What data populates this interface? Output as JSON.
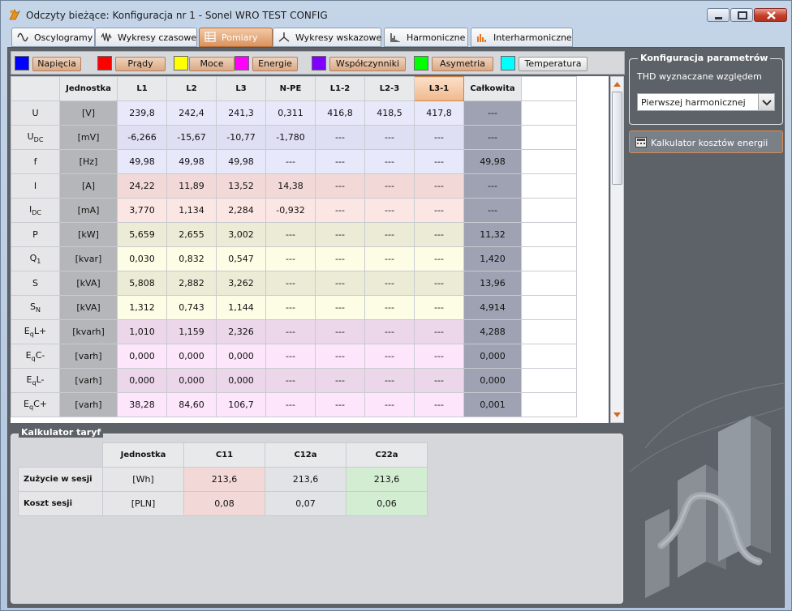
{
  "window": {
    "title": "Odczyty bieżące: Konfiguracja nr 1 - Sonel WRO TEST CONFIG"
  },
  "tabs": [
    {
      "label": "Oscylogramy",
      "icon": "sine-wave-icon",
      "active": false
    },
    {
      "label": "Wykresy czasowe",
      "icon": "waveform-icon",
      "active": false
    },
    {
      "label": "Pomiary",
      "icon": "table-icon",
      "active": true
    },
    {
      "label": "Wykresy wskazowe",
      "icon": "phasor-icon",
      "active": false
    },
    {
      "label": "Harmoniczne",
      "icon": "bar-chart-icon",
      "active": false
    },
    {
      "label": "Interharmoniczne",
      "icon": "bar-chart-color-icon",
      "active": false
    }
  ],
  "filters": [
    {
      "label": "Napięcia",
      "color": "#0000ff",
      "on": true
    },
    {
      "label": "Prądy",
      "color": "#ff0000",
      "on": true
    },
    {
      "label": "Moce",
      "color": "#ffff00",
      "on": true
    },
    {
      "label": "Energie",
      "color": "#ff00ff",
      "on": true
    },
    {
      "label": "Współczynniki",
      "color": "#8000ff",
      "on": true
    },
    {
      "label": "Asymetria",
      "color": "#00ff00",
      "on": true
    },
    {
      "label": "Temperatura",
      "color": "#00ffff",
      "on": false
    }
  ],
  "measurements": {
    "headers": [
      "",
      "Jednostka",
      "L1",
      "L2",
      "L3",
      "N-PE",
      "L1-2",
      "L2-3",
      "L3-1",
      "Całkowita"
    ],
    "selected_column": "L3-1",
    "rows": [
      {
        "param": "U",
        "sub": "",
        "suffix": "",
        "unit": "[V]",
        "values": [
          "239,8",
          "242,4",
          "241,3",
          "0,311",
          "416,8",
          "418,5",
          "417,8",
          "---"
        ],
        "bg": "#e8e8fb"
      },
      {
        "param": "U",
        "sub": "DC",
        "suffix": "",
        "unit": "[mV]",
        "values": [
          "-6,266",
          "-15,67",
          "-10,77",
          "-1,780",
          "---",
          "---",
          "---",
          "---"
        ],
        "bg": "#dfdff4"
      },
      {
        "param": "f",
        "sub": "",
        "suffix": "",
        "unit": "[Hz]",
        "values": [
          "49,98",
          "49,98",
          "49,98",
          "---",
          "---",
          "---",
          "---",
          "49,98"
        ],
        "bg": "#e8e8fb"
      },
      {
        "param": "I",
        "sub": "",
        "suffix": "",
        "unit": "[A]",
        "values": [
          "24,22",
          "11,89",
          "13,52",
          "14,38",
          "---",
          "---",
          "---",
          "---"
        ],
        "bg": "#f2d9d7"
      },
      {
        "param": "I",
        "sub": "DC",
        "suffix": "",
        "unit": "[mA]",
        "values": [
          "3,770",
          "1,134",
          "2,284",
          "-0,932",
          "---",
          "---",
          "---",
          "---"
        ],
        "bg": "#fbe6e4"
      },
      {
        "param": "P",
        "sub": "",
        "suffix": "",
        "unit": "[kW]",
        "values": [
          "5,659",
          "2,655",
          "3,002",
          "---",
          "---",
          "---",
          "---",
          "11,32"
        ],
        "bg": "#ecebd6"
      },
      {
        "param": "Q",
        "sub": "1",
        "suffix": "",
        "unit": "[kvar]",
        "values": [
          "0,030",
          "0,832",
          "0,547",
          "---",
          "---",
          "---",
          "---",
          "1,420"
        ],
        "bg": "#fdfde6"
      },
      {
        "param": "S",
        "sub": "",
        "suffix": "",
        "unit": "[kVA]",
        "values": [
          "5,808",
          "2,882",
          "3,262",
          "---",
          "---",
          "---",
          "---",
          "13,96"
        ],
        "bg": "#ecebd6"
      },
      {
        "param": "S",
        "sub": "N",
        "suffix": "",
        "unit": "[kVA]",
        "values": [
          "1,312",
          "0,743",
          "1,144",
          "---",
          "---",
          "---",
          "---",
          "4,914"
        ],
        "bg": "#fdfde6"
      },
      {
        "param": "E",
        "sub": "q",
        "suffix": "L+",
        "unit": "[kvarh]",
        "values": [
          "1,010",
          "1,159",
          "2,326",
          "---",
          "---",
          "---",
          "---",
          "4,288"
        ],
        "bg": "#ecd6ea"
      },
      {
        "param": "E",
        "sub": "q",
        "suffix": "C-",
        "unit": "[varh]",
        "values": [
          "0,000",
          "0,000",
          "0,000",
          "---",
          "---",
          "---",
          "---",
          "0,000"
        ],
        "bg": "#fde6fb"
      },
      {
        "param": "E",
        "sub": "q",
        "suffix": "L-",
        "unit": "[varh]",
        "values": [
          "0,000",
          "0,000",
          "0,000",
          "---",
          "---",
          "---",
          "---",
          "0,000"
        ],
        "bg": "#ecd6ea"
      },
      {
        "param": "E",
        "sub": "q",
        "suffix": "C+",
        "unit": "[varh]",
        "values": [
          "38,28",
          "84,60",
          "106,7",
          "---",
          "---",
          "---",
          "---",
          "0,001"
        ],
        "bg": "#fde6fb"
      }
    ]
  },
  "tariff": {
    "title": "Kalkulator taryf",
    "headers": [
      "",
      "Jednostka",
      "C11",
      "C12a",
      "C22a"
    ],
    "col_colors": [
      "#f2d9d7",
      "#e2e3e6",
      "#d3edd3"
    ],
    "rows": [
      {
        "label": "Zużycie w sesji",
        "unit": "[Wh]",
        "values": [
          "213,6",
          "213,6",
          "213,6"
        ]
      },
      {
        "label": "Koszt sesji",
        "unit": "[PLN]",
        "values": [
          "0,08",
          "0,07",
          "0,06"
        ]
      }
    ]
  },
  "config": {
    "title": "Konfiguracja parametrów",
    "thd_label": "THD wyznaczane względem",
    "thd_value": "Pierwszej harmonicznej",
    "calc_button": "Kalkulator kosztów energii"
  }
}
